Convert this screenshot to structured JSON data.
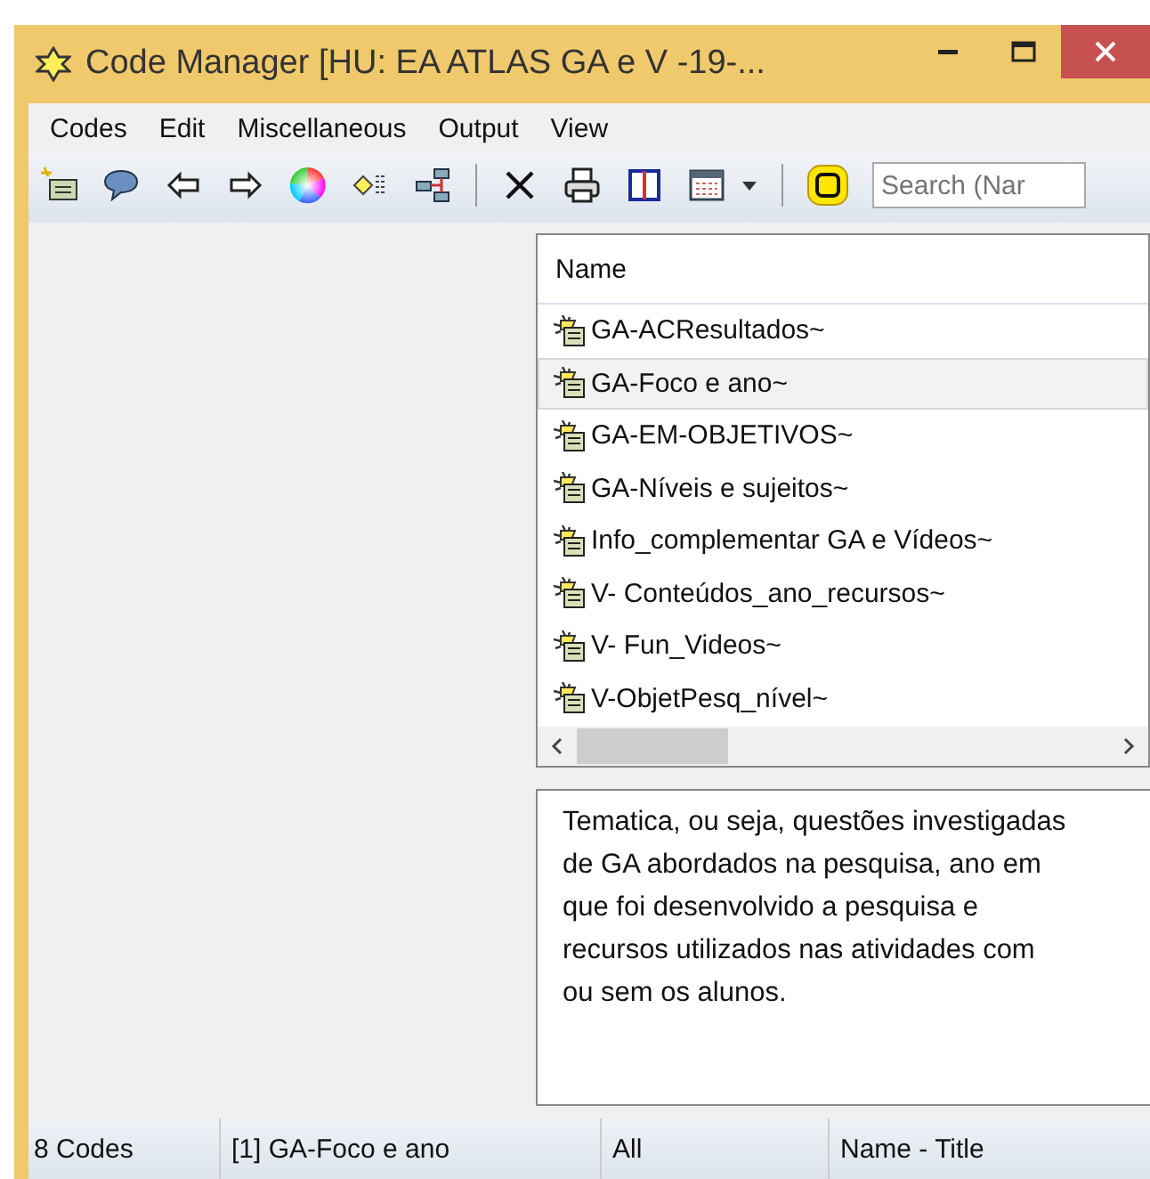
{
  "window": {
    "title": "Code Manager [HU: EA ATLAS GA e V -19-..."
  },
  "menu": [
    "Codes",
    "Edit",
    "Miscellaneous",
    "Output",
    "View"
  ],
  "search": {
    "placeholder": "Search (Nar"
  },
  "list": {
    "column": "Name",
    "rows": [
      {
        "name": "GA-ACResultados~",
        "selected": false
      },
      {
        "name": "GA-Foco e ano~",
        "selected": true
      },
      {
        "name": "GA-EM-OBJETIVOS~",
        "selected": false
      },
      {
        "name": "GA-Níveis e sujeitos~",
        "selected": false
      },
      {
        "name": "Info_complementar GA e Vídeos~",
        "selected": false
      },
      {
        "name": "V- Conteúdos_ano_recursos~",
        "selected": false
      },
      {
        "name": "V- Fun_Videos~",
        "selected": false
      },
      {
        "name": "V-ObjetPesq_nível~",
        "selected": false
      }
    ]
  },
  "comment": [
    "Tematica, ou seja, questões investigadas",
    "de GA abordados na pesquisa, ano em",
    "que foi desenvolvido a pesquisa e",
    "recursos utilizados nas atividades com",
    "ou sem os alunos."
  ],
  "status_bar": [
    "8 Codes",
    "[1] GA-Foco e ano",
    "All",
    "Name - Title"
  ]
}
